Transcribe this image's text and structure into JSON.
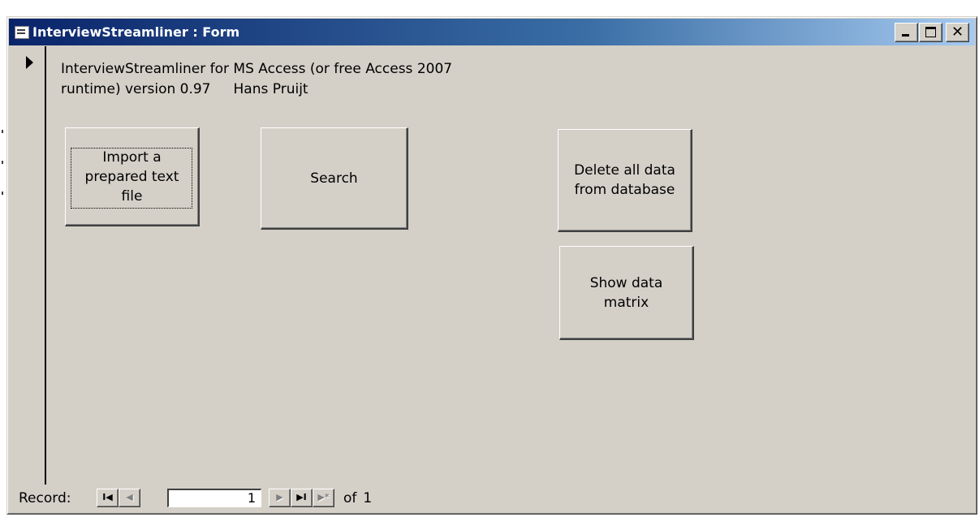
{
  "window": {
    "title": "InterviewStreamliner : Form",
    "minimize_glyph": "_",
    "maximize_glyph": "□",
    "close_glyph": "✕"
  },
  "form": {
    "info_line1": "InterviewStreamliner for MS Access (or free Access 2007",
    "info_line2_a": "runtime)  version 0.97",
    "info_line2_b": "Hans Pruijt",
    "buttons": {
      "import_line1": "Import a",
      "import_line2": "prepared text",
      "import_line3": "file",
      "search": "Search",
      "delete_line1": "Delete all data",
      "delete_line2": "from database",
      "matrix_line1": "Show data",
      "matrix_line2": "matrix"
    }
  },
  "navigation": {
    "label": "Record:",
    "current_record": "1",
    "of_label": "of",
    "total_records": "1",
    "first_glyph": "I◀",
    "prev_glyph": "◀",
    "next_glyph": "▶",
    "last_glyph": "▶I",
    "new_glyph": "▶*"
  }
}
